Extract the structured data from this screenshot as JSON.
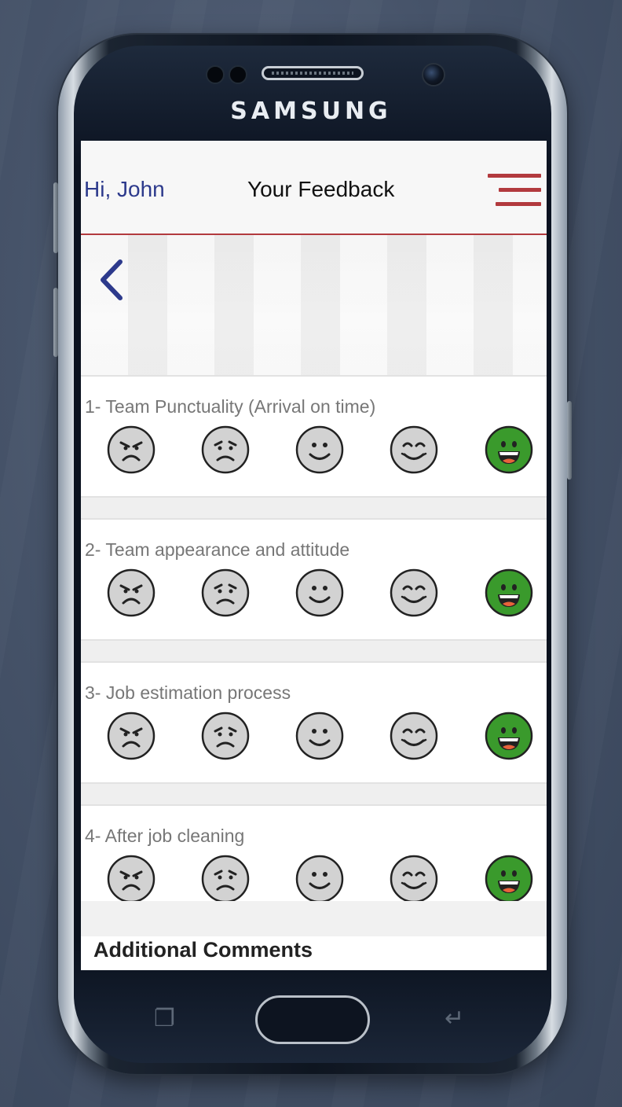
{
  "device": {
    "brand": "SAMSUNG"
  },
  "header": {
    "greeting": "Hi, John",
    "title": "Your Feedback"
  },
  "icons": {
    "back": "chevron-left-icon",
    "menu": "hamburger-menu-icon"
  },
  "colors": {
    "accent": "#b23a3e",
    "greeting": "#2d3a8c",
    "selected_face": "#3a9a2c",
    "face": "#d2d2d2"
  },
  "rating_scale": [
    "angry",
    "sad",
    "neutral",
    "happy",
    "very-happy"
  ],
  "questions": [
    {
      "label": "1- Team Punctuality (Arrival on time)",
      "selected": "very-happy"
    },
    {
      "label": "2- Team appearance and attitude",
      "selected": "very-happy"
    },
    {
      "label": "3- Job estimation process",
      "selected": "very-happy"
    },
    {
      "label": "4- After job cleaning",
      "selected": "very-happy"
    }
  ],
  "comments": {
    "heading": "Additional Comments"
  }
}
